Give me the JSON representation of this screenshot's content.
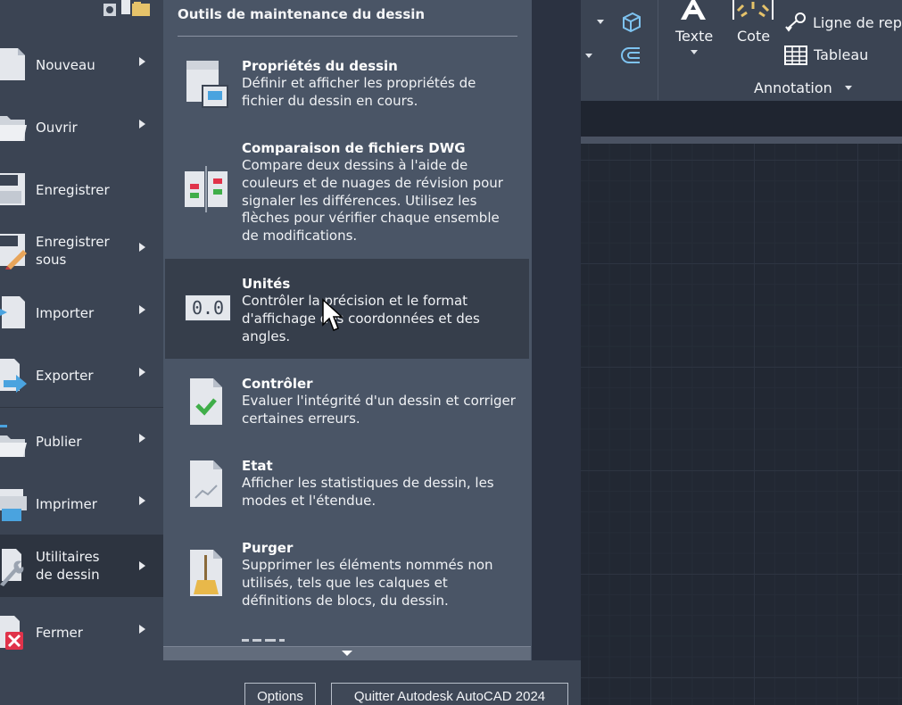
{
  "left_menu": {
    "items": [
      {
        "label": "Nouveau"
      },
      {
        "label": "Ouvrir"
      },
      {
        "label": "Enregistrer"
      },
      {
        "label": "Enregistrer\nsous"
      },
      {
        "label": "Importer"
      },
      {
        "label": "Exporter"
      },
      {
        "label": "Publier"
      },
      {
        "label": "Imprimer"
      },
      {
        "label": "Utilitaires\nde dessin"
      },
      {
        "label": "Fermer"
      }
    ]
  },
  "panel": {
    "title": "Outils de maintenance du dessin",
    "items": [
      {
        "title": "Propriétés du dessin",
        "desc": "Définir et afficher les propriétés de fichier du dessin en cours."
      },
      {
        "title": "Comparaison de fichiers DWG",
        "desc": "Compare deux dessins à l'aide de couleurs et de nuages de révision pour signaler les différences. Utilisez les flèches pour vérifier chaque ensemble de modifications."
      },
      {
        "title": "Unités",
        "desc": "Contrôler la précision et le format d'affichage des coordonnées et des angles.",
        "icon_text": "0.0"
      },
      {
        "title": "Contrôler",
        "desc": "Evaluer l'intégrité d'un dessin et corriger certaines erreurs."
      },
      {
        "title": "Etat",
        "desc": "Afficher les statistiques de dessin, les modes et l'étendue."
      },
      {
        "title": "Purger",
        "desc": "Supprimer les éléments nommés non utilisés, tels que les calques et définitions de blocs, du dessin."
      }
    ]
  },
  "bottom": {
    "options_label": "Options",
    "quit_label": "Quitter Autodesk AutoCAD 2024"
  },
  "ribbon": {
    "texte_label": "Texte",
    "cote_label": "Cote",
    "ligne_label": "Ligne de rep",
    "tableau_label": "Tableau",
    "annotation_label": "Annotation"
  },
  "colors": {
    "menu_bg": "#3b4453",
    "panel_bg": "#4a5566",
    "active_bg": "#363e4b",
    "canvas_bg": "#222833",
    "check_green": "#3fae49",
    "delete_red": "#e0334a",
    "broom_yellow": "#e8b84a"
  }
}
